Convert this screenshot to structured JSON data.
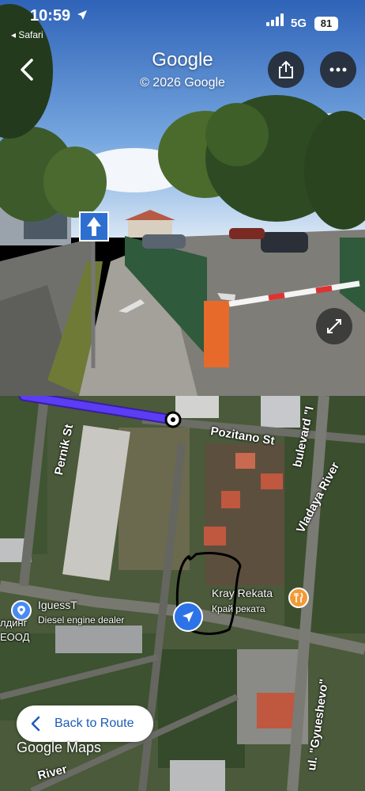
{
  "status_bar": {
    "time": "10:59",
    "back_app": "◂ Safari",
    "network": "5G",
    "battery": "81"
  },
  "street_view": {
    "title": "Google",
    "copyright": "© 2026 Google"
  },
  "map": {
    "streets": {
      "pernik": "Pernik St",
      "pozitano": "Pozitano St",
      "boulevard": "bulevard \"I",
      "vladaya": "Vladaya River",
      "gyueshevo": "ul. \"Gyueshevo\"",
      "river": "River"
    },
    "pois": {
      "iguess_name": "IguessT",
      "iguess_category": "Diesel engine dealer",
      "kray_name": "Kray Rekata",
      "kray_cyrillic": "Край реката",
      "cut_label_1": "лдинг",
      "cut_label_2": "ЕООД"
    },
    "back_to_route": "Back to Route",
    "brand": "Google Maps",
    "route_color": "#5b3df5"
  }
}
